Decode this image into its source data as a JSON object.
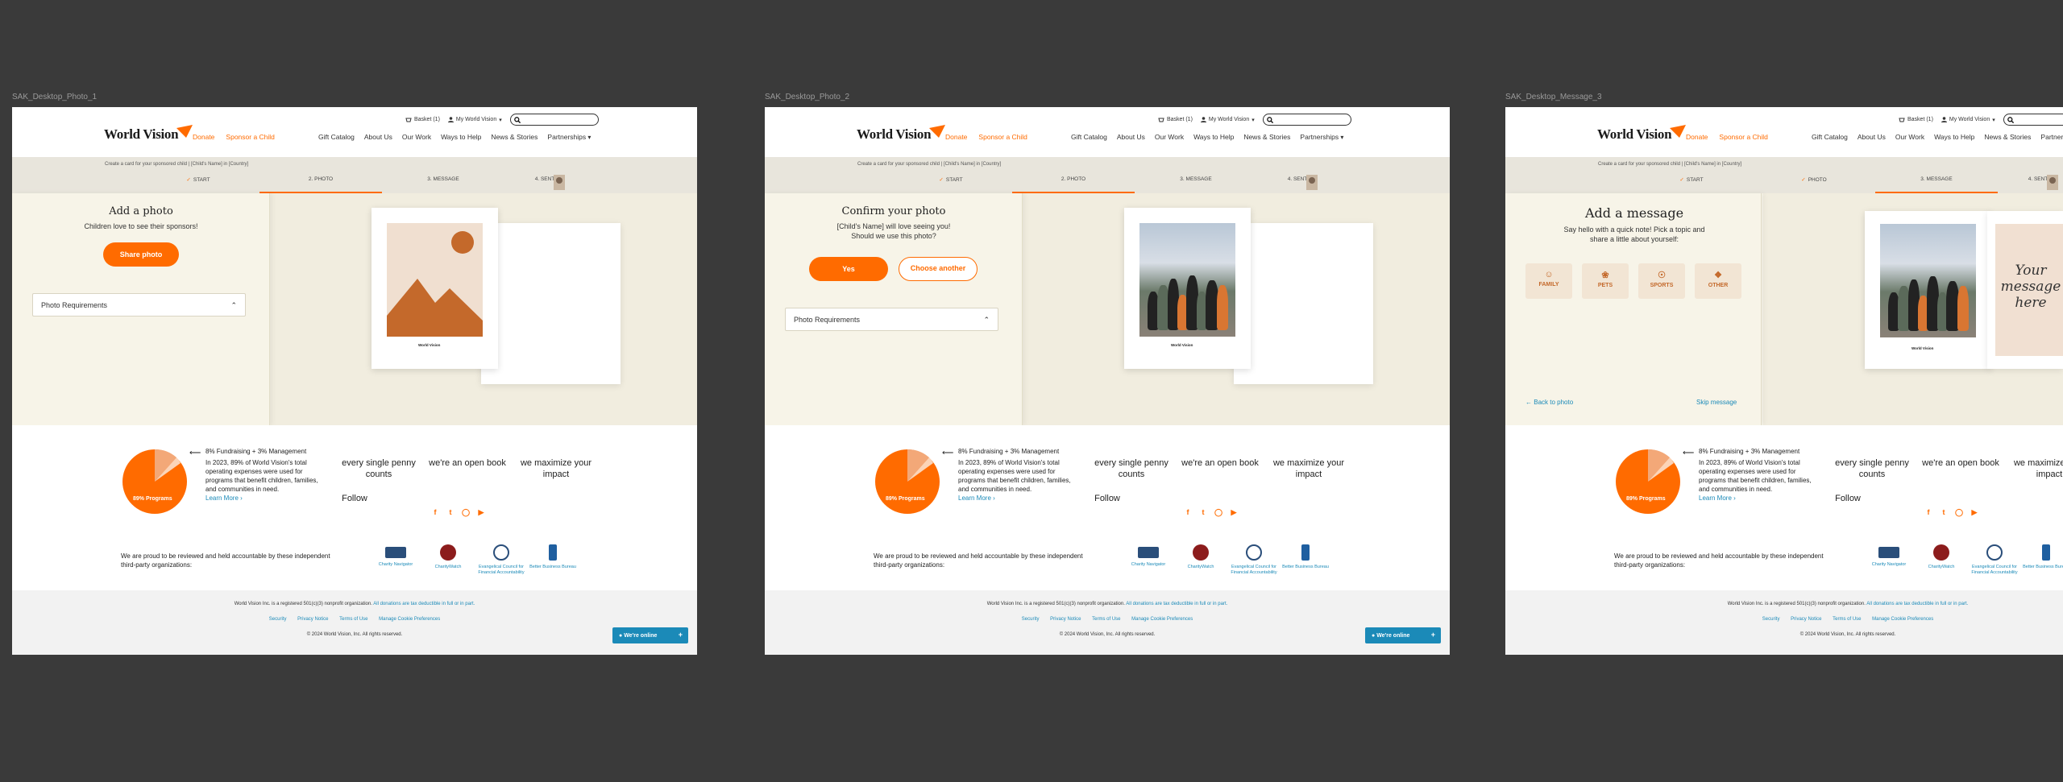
{
  "frames": [
    {
      "label": "SAK_Desktop_Photo_1",
      "active_step": 1,
      "panel": {
        "title": "Add a photo",
        "subtitle": "Children love to see their sponsors!",
        "button": "Share photo",
        "accordion": "Photo Requirements"
      }
    },
    {
      "label": "SAK_Desktop_Photo_2",
      "active_step": 1,
      "panel": {
        "title": "Confirm your photo",
        "subtitle_1": "[Child's Name] will love seeing you!",
        "subtitle_2": "Should we use this photo?",
        "yes": "Yes",
        "choose": "Choose another",
        "accordion": "Photo Requirements"
      }
    },
    {
      "label": "SAK_Desktop_Message_3",
      "active_step": 2,
      "panel": {
        "title": "Add a message",
        "subtitle_1": "Say hello with a quick note! Pick a topic and",
        "subtitle_2": "share a little about yourself:",
        "categories": [
          "FAMILY",
          "PETS",
          "SPORTS",
          "OTHER"
        ],
        "back": "Back to photo",
        "skip": "Skip message",
        "message_placeholder": "Your message here"
      }
    }
  ],
  "header": {
    "basket": "Basket (1)",
    "account": "My World Vision",
    "logo": "World Vision",
    "donate": "Donate",
    "sponsor": "Sponsor a Child",
    "nav": [
      "Gift Catalog",
      "About Us",
      "Our Work",
      "Ways to Help",
      "News & Stories",
      "Partnerships"
    ]
  },
  "breadcrumb": "Create a card for your sponsored child  |  [Child's Name] in [Country]",
  "steps": [
    "START",
    "PHOTO",
    "MESSAGE",
    "SENT"
  ],
  "step_numbers": [
    "1.",
    "2.",
    "3.",
    "4."
  ],
  "card_logo": "World Vision",
  "footer": {
    "pie_label": "89% Programs",
    "fund_line": "8% Fundraising + 3% Management",
    "fund_body": "In 2023, 89% of World Vision's total operating expenses were used for programs that benefit children, families, and communities in need.",
    "learn_more": "Learn More",
    "tags": [
      "every single penny counts",
      "we're an open book",
      "we maximize your impact"
    ],
    "follow": "Follow",
    "proud": "We are proud to be reviewed and held accountable by these independent third-party organizations:",
    "badges": [
      "Charity Navigator",
      "CharityWatch",
      "Evangelical Council for Financial Accountability",
      "Better Business Bureau"
    ],
    "legal_1": "World Vision Inc. is a registered 501(c)(3) nonprofit organization.",
    "legal_1_link": "All donations are tax deductible in full or in part.",
    "legal_links": [
      "Security",
      "Privacy Notice",
      "Terms of Use",
      "Manage Cookie Preferences"
    ],
    "copyright": "© 2024 World Vision, Inc. All rights reserved.",
    "chat": "We're online",
    "chat_plus": "+"
  },
  "colors": {
    "accent": "#ff6b00",
    "link": "#1b8ab8",
    "canvas": "#3a3a3a",
    "panel": "#f7f4e8"
  }
}
